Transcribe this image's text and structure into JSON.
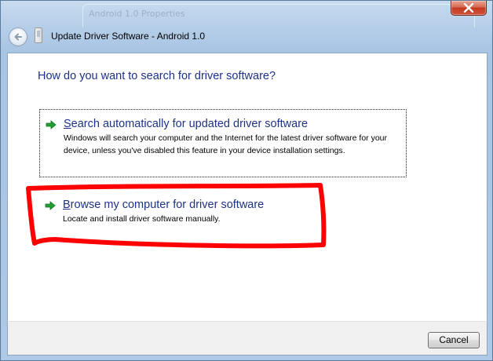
{
  "background_window": {
    "title": "Android 1.0 Properties"
  },
  "window": {
    "title": "Update Driver Software - Android 1.0",
    "close_glyph": "✕"
  },
  "main": {
    "heading": "How do you want to search for driver software?",
    "options": [
      {
        "title_first": "S",
        "title_rest": "earch automatically for updated driver software",
        "description": "Windows will search your computer and the Internet for the latest driver software for your device, unless you've disabled this feature in your device installation settings.",
        "icon": "green-arrow-icon"
      },
      {
        "title_first": "B",
        "title_rest": "rowse my computer for driver software",
        "description": "Locate and install driver software manually.",
        "icon": "green-arrow-icon",
        "highlighted": true
      }
    ]
  },
  "footer": {
    "cancel_label": "Cancel"
  },
  "colors": {
    "link_blue": "#1e3287",
    "arrow_green": "#22a033",
    "annotation_red": "#ff0000",
    "close_red": "#c23a20"
  }
}
